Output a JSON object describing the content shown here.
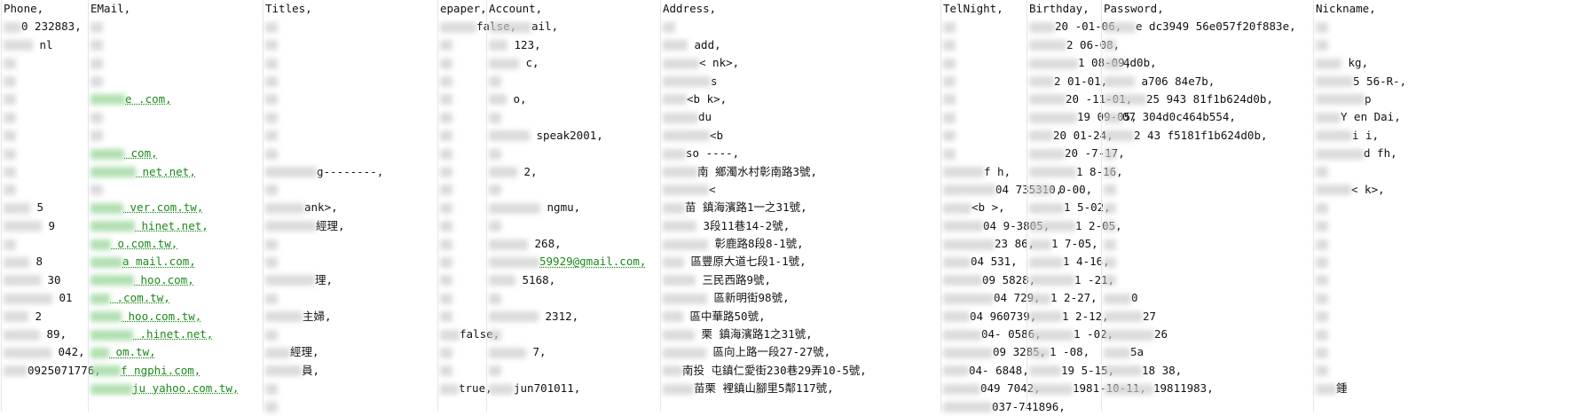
{
  "columns": [
    {
      "key": "phone",
      "header": "Phone,",
      "cells": [
        "0 232883,",
        "  nl",
        "",
        "",
        "",
        "",
        "",
        "",
        "",
        "",
        "  5",
        "  9",
        "",
        "  8",
        "  30",
        "  01",
        "  2",
        "  89,",
        "  042,",
        "0925071776,"
      ]
    },
    {
      "key": "email",
      "header": "EMail,",
      "cells": [
        "",
        "",
        "",
        "",
        "e .com,",
        "",
        "",
        "  com,",
        "  net.net,",
        "",
        "  ver.com.tw,",
        "  hinet.net,",
        "  o.com.tw,",
        "a  mail.com,",
        "  hoo.com,",
        "  .com.tw,",
        "  hoo.com.tw,",
        "  .hinet.net,",
        "  om.tw,",
        "f  ngphi.com,",
        "ju  yahoo.com.tw,"
      ]
    },
    {
      "key": "titles",
      "header": "Titles,",
      "cells": [
        "",
        "",
        "",
        "",
        "",
        "",
        "",
        "",
        "g--------,",
        "",
        "ank>,",
        "經理,",
        "",
        "",
        "理,",
        "",
        "主婦,",
        "",
        "經理,",
        "員,",
        "",
        ""
      ]
    },
    {
      "key": "epaper",
      "header": "epaper,",
      "cells": [
        "false,",
        "",
        "",
        "",
        "",
        "",
        "",
        "",
        "",
        "",
        "",
        "",
        "",
        "",
        "",
        "",
        "",
        "false,",
        "",
        "",
        "true,"
      ]
    },
    {
      "key": "account",
      "header": "Account,",
      "cells": [
        "ail,",
        "  123,",
        "  c,",
        "",
        "  o,",
        "",
        "  speak2001,",
        "",
        "  2,",
        "",
        "  ngmu,",
        "",
        "  268,",
        "59929@gmail.com,",
        "  5168,",
        "",
        "  2312,",
        "",
        "  7,",
        "",
        "jun701011,"
      ]
    },
    {
      "key": "address",
      "header": "Address,",
      "cells": [
        "",
        "  add,",
        "<  nk>,",
        "s",
        "<b  k>,",
        "du",
        "<b",
        "so  ----,",
        "南  鄉濁水村彰南路3號,",
        "<",
        "苗  鎮海濱路1一之31號,",
        "  3段11巷14-2號,",
        "  彰鹿路8段8-1號,",
        "  區豐原大道七段1-1號,",
        "  三民西路9號,",
        "  區新明街98號,",
        "  區中華路50號,",
        "  栗  鎮海濱路1之31號,",
        "  區向上路一段27-27號,",
        "南投  屯鎮仁愛街230巷29弄10-5號,",
        "苗栗  裡鎮山腳里5鄰117號,"
      ]
    },
    {
      "key": "telnight",
      "header": "TelNight,",
      "cells": [
        "",
        "",
        "",
        "",
        "",
        "",
        "",
        "",
        "f  h,",
        "04  735310,",
        "<b  >,",
        "04  9-3805,",
        "23  86,",
        "04  531,",
        "09  5828,",
        "04  729,",
        "04   960739,",
        "04-  0586,",
        "09  3285,",
        "04-  6848,",
        "049  7042,",
        "037-741896,"
      ]
    },
    {
      "key": "birthday",
      "header": "Birthday,",
      "cells": [
        "20  -01-06,",
        "2  06-08,",
        "1  08-09,",
        "2  01-01,",
        "20  -11-01,",
        "19  09-05,",
        "20  01-24,",
        "20  -7-17,",
        "1  8-16,",
        "  0-00,",
        "1  5-02,",
        "1  2-05,",
        "1  7-05,",
        "1  4-16,",
        "1  -21,",
        "1  2-27,",
        "1  2-12,",
        "1  -02,",
        "1  -08,",
        "19  5-15,",
        "1981-10-11,"
      ]
    },
    {
      "key": "password",
      "header": "Password,",
      "cells": [
        "e  dc3949  56e057f20f883e,",
        "",
        "4d0b,",
        "  a706  84e7b,",
        "25  943  81f1b624d0b,",
        "07  304d0c464b554,",
        "2  43  f5181f1b624d0b,",
        "",
        "",
        "",
        "",
        "",
        "",
        "",
        "",
        "0",
        "27",
        "26",
        "5a",
        "18  38,",
        "19811983,"
      ]
    },
    {
      "key": "nickname",
      "header": "Nickname,",
      "cells": [
        "",
        "",
        "  kg,",
        "5  56-R-,",
        "p",
        "Y  en Dai,",
        "i  i,",
        "d  fh,",
        "",
        "<  k>,",
        "",
        "",
        "",
        "",
        "",
        "",
        "",
        "",
        "",
        "",
        "鍾"
      ]
    }
  ]
}
